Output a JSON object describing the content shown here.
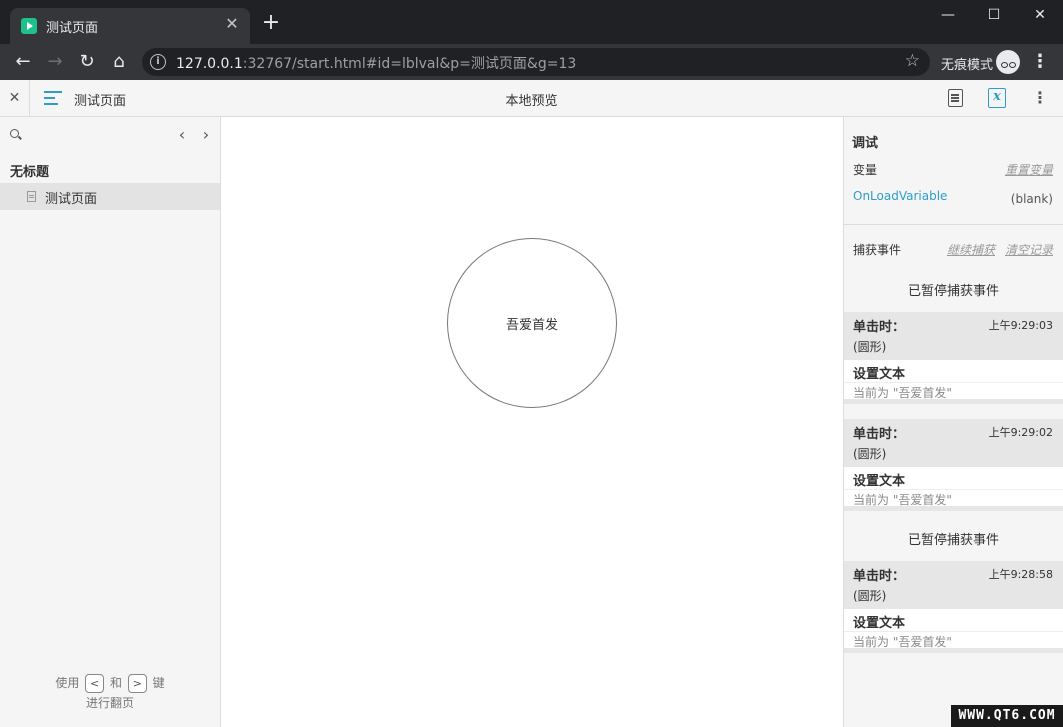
{
  "browser": {
    "tab_title": "测试页面",
    "tab_close": "✕",
    "new_tab": "+",
    "window_buttons": {
      "minimize": "—",
      "maximize": "☐",
      "close": "✕"
    },
    "nav": {
      "back": "←",
      "forward": "→",
      "reload": "↻",
      "home": "⌂"
    },
    "url_host": "127.0.0.1",
    "url_rest": ":32767/start.html#id=lblval&p=测试页面&g=13",
    "info_icon": "i",
    "star_icon": "☆",
    "incognito_label": "无痕模式",
    "menu_icon": "⋮"
  },
  "header": {
    "close": "✕",
    "page_name": "测试页面",
    "title": "本地预览",
    "console_icon_glyph": "x",
    "more_icon": "⋮"
  },
  "sidebar": {
    "prev": "‹",
    "next": "›",
    "project_title": "无标题",
    "pages": [
      {
        "label": "测试页面",
        "selected": true
      }
    ],
    "hint": {
      "use": "使用",
      "key1": "<",
      "and": "和",
      "key2": ">",
      "key_word": "键",
      "line2": "进行翻页"
    }
  },
  "canvas": {
    "circle_label": "吾爱首发"
  },
  "console": {
    "heading": "调试",
    "variables_label": "变量",
    "reset_variables": "重置变量",
    "variable": {
      "name": "OnLoadVariable",
      "value": "(blank)"
    },
    "events_label": "捕获事件",
    "resume_capture": "继续捕获",
    "clear_log": "清空记录",
    "paused_1": "已暂停捕获事件",
    "events": [
      {
        "name": "单击时：",
        "time": "上午9:29:03",
        "target": "(圆形)",
        "action": "设置文本",
        "detail": "当前为 \"吾爱首发\""
      },
      {
        "name": "单击时：",
        "time": "上午9:29:02",
        "target": "(圆形)",
        "action": "设置文本",
        "detail": "当前为 \"吾爱首发\""
      },
      {
        "name": "单击时：",
        "time": "上午9:28:58",
        "target": "(圆形)",
        "action": "设置文本",
        "detail": "当前为 \"吾爱首发\""
      }
    ],
    "paused_2": "已暂停捕获事件"
  },
  "watermark": "WWW.QT6.COM",
  "colors": {
    "accent": "#2c9ec9",
    "favicon": "#1ec08b",
    "chrome_dark": "#202124",
    "chrome_toolbar": "#35363a"
  }
}
